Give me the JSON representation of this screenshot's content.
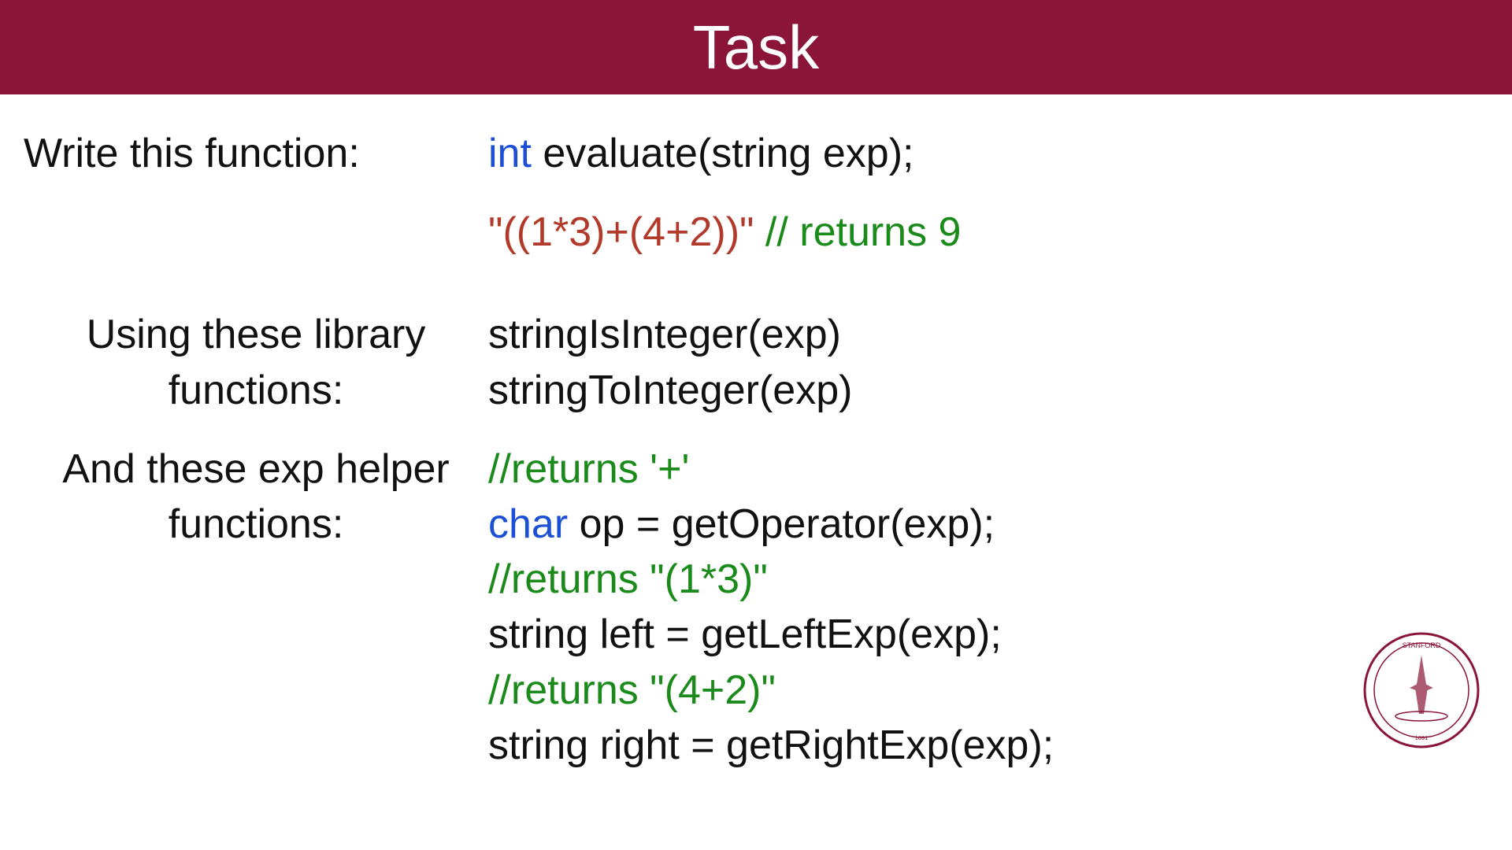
{
  "header": {
    "title": "Task"
  },
  "section1": {
    "label": "Write this function:",
    "sig_kw": "int",
    "sig_rest": " evaluate(string exp);",
    "example_input": "\"((1*3)+(4+2))\" ",
    "example_comment": "// returns 9"
  },
  "section2": {
    "label": "Using these library functions:",
    "lib1": "stringIsInteger(exp)",
    "lib2": "stringToInteger(exp)"
  },
  "section3": {
    "label": "And these exp helper functions:",
    "c1": "//returns '+'",
    "l2_kw": "char",
    "l2_rest": " op = getOperator(exp);",
    "c3": "//returns \"(1*3)\"",
    "l4": "string left = getLeftExp(exp);",
    "c5": "//returns \"(4+2)\"",
    "l6": "string right = getRightExp(exp);"
  }
}
